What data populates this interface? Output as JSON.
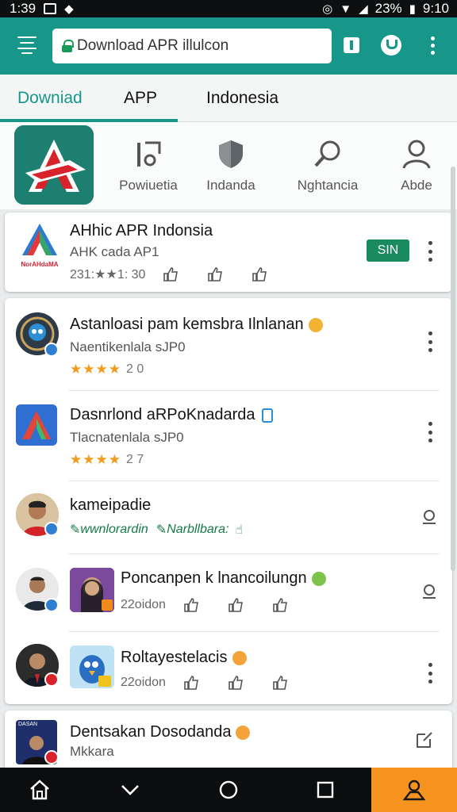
{
  "status_bar": {
    "time": "1:39",
    "battery": "23%",
    "clock": "9:10"
  },
  "app_bar": {
    "url": "Download APR illulcon"
  },
  "tabs": [
    {
      "label": "Downiad"
    },
    {
      "label": "APP"
    },
    {
      "label": "Indonesia"
    }
  ],
  "categories": [
    {
      "label": "Powiuetia",
      "icon": "chart-icon"
    },
    {
      "label": "Indanda",
      "icon": "shield-icon"
    },
    {
      "label": "Nghtancia",
      "icon": "search-icon"
    },
    {
      "label": "Abde",
      "icon": "person-icon"
    }
  ],
  "featured": {
    "title": "AHhic APR Indonsia",
    "logo_text": "NorAHdaMA",
    "subtitle": "AHK cada AP1",
    "meta": "231:★★1: 30",
    "button": "SIN"
  },
  "list": [
    {
      "title": "Astanloasi pam kemsbra Ilnlanan",
      "subtitle": "Naentikenlala sJP0",
      "stars": "★★★★",
      "rating": "2 0"
    },
    {
      "title": "Dasnrlond aRPoKnadarda",
      "subtitle": "Tlacnatenlala sJP0",
      "stars": "★★★★",
      "rating": "2 7"
    },
    {
      "title": "kameipadie",
      "link1": "wwnlorardin",
      "link2": "Narbllbara:"
    },
    {
      "title": "Poncanpen k lnancoilungn",
      "meta": "22oidon"
    },
    {
      "title": "Roltayestelacis",
      "meta": "22oidon"
    }
  ],
  "partial": {
    "title": "Dentsakan Dosodanda",
    "subtitle": "Mkkara",
    "badge": "DASAN"
  },
  "colors": {
    "primary": "#17968a",
    "accent": "#f79420",
    "install": "#1a8a5f",
    "star": "#f29a1a"
  }
}
